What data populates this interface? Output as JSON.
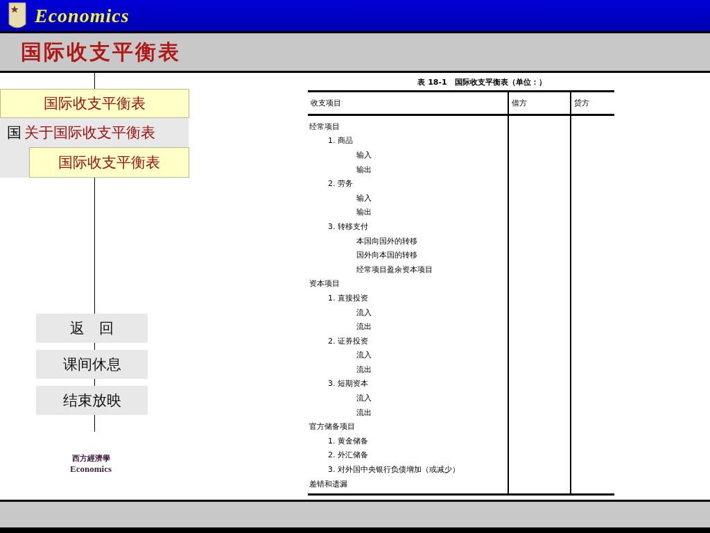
{
  "header": {
    "brand": "Economics",
    "title": "国际收支平衡表"
  },
  "menu": [
    {
      "kind": "highlight",
      "label": "国际收支平衡表"
    },
    {
      "kind": "overlap",
      "label": "国",
      "overlay": "关于国际收支平衡表"
    },
    {
      "kind": "popup",
      "popup": "国际收支平衡表"
    }
  ],
  "nav_buttons": [
    "返　回",
    "课间休息",
    "结束放映"
  ],
  "footer_logo": {
    "line_1": "西方經濟學",
    "line_2": "Economics"
  },
  "table": {
    "caption": "表 18-1　国际收支平衡表（单位：）",
    "columns": [
      "收支项目",
      "借方",
      "贷方"
    ],
    "rows": [
      {
        "label": "经常项目",
        "children": [
          {
            "label": "1. 商品",
            "children": [
              {
                "label": "输入"
              },
              {
                "label": "输出"
              }
            ]
          },
          {
            "label": "2. 劳务",
            "children": [
              {
                "label": "输入"
              },
              {
                "label": "输出"
              }
            ]
          },
          {
            "label": "3. 转移支付",
            "children": [
              {
                "label": "本国向国外的转移"
              },
              {
                "label": "国外向本国的转移"
              },
              {
                "label": "经常项目盈余资本项目"
              }
            ]
          }
        ]
      },
      {
        "label": "资本项目",
        "children": [
          {
            "label": "1. 直接投资",
            "children": [
              {
                "label": "流入"
              },
              {
                "label": "流出"
              }
            ]
          },
          {
            "label": "2. 证券投资",
            "children": [
              {
                "label": "流入"
              },
              {
                "label": "流出"
              }
            ]
          },
          {
            "label": "3. 短期资本",
            "children": [
              {
                "label": "流入"
              },
              {
                "label": "流出"
              }
            ]
          }
        ]
      },
      {
        "label": "官方储备项目",
        "children": [
          {
            "label": "1. 黄金储备"
          },
          {
            "label": "2. 外汇储备"
          },
          {
            "label": "3. 对外国中央银行负债增加（或减少）"
          }
        ]
      },
      {
        "label": "差错和遗漏"
      }
    ]
  }
}
